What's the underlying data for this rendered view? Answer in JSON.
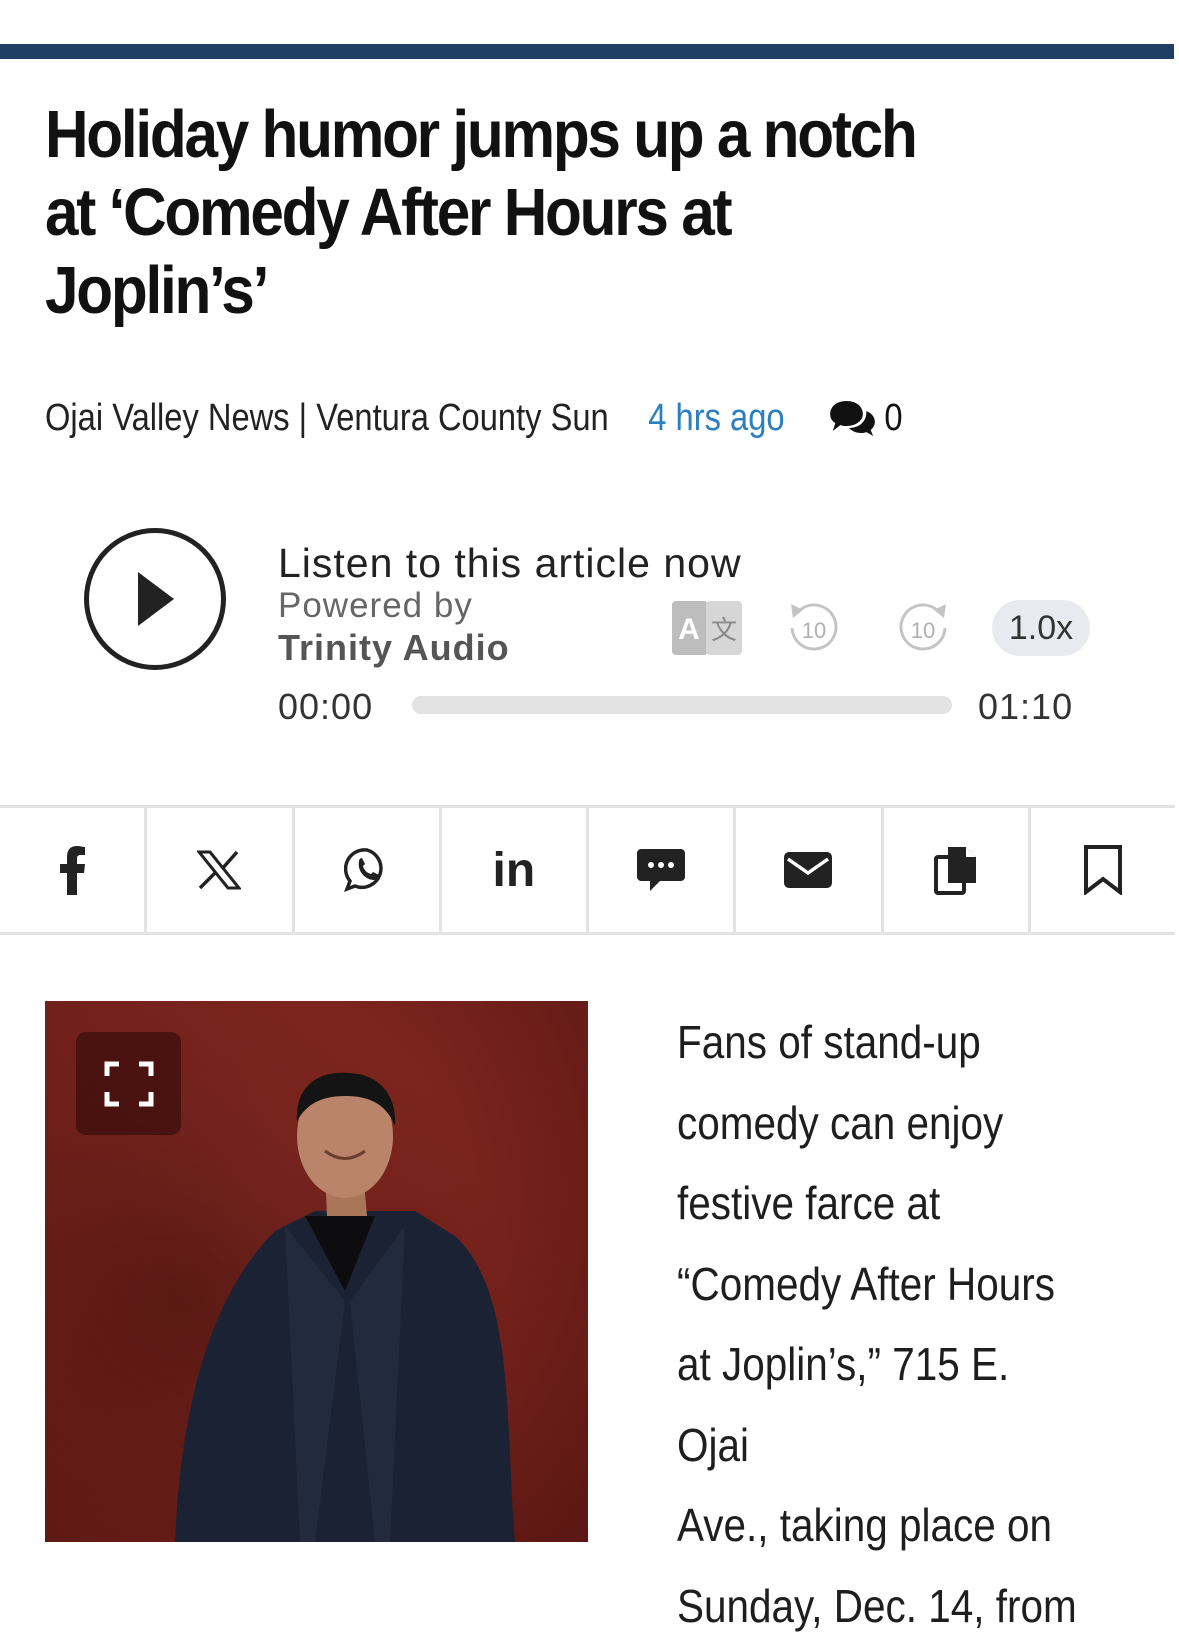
{
  "article": {
    "headline": "Holiday humor jumps up a notch at ‘Comedy After Hours at Joplin’s’",
    "source": "Ojai Valley News | Ventura County Sun",
    "time_ago": "4 hrs ago",
    "comment_count": "0",
    "body_lines": [
      "Fans of stand-up",
      "comedy can enjoy",
      "festive farce at",
      "“Comedy After Hours",
      "at Joplin’s,” 715 E. Ojai",
      "Ave., taking place on",
      "Sunday, Dec. 14, from"
    ]
  },
  "audio_player": {
    "title": "Listen to this article now",
    "powered_by": "Powered by",
    "provider": "Trinity Audio",
    "translate_label": "A文",
    "rewind_seconds": "10",
    "forward_seconds": "10",
    "speed": "1.0x",
    "current_time": "00:00",
    "duration": "01:10",
    "progress": 0
  },
  "share_bar": {
    "buttons": [
      "facebook-icon",
      "x-icon",
      "whatsapp-icon",
      "linkedin-icon",
      "sms-icon",
      "email-icon",
      "copy-icon",
      "bookmark-icon"
    ],
    "linkedin_label": "in"
  },
  "colors": {
    "brand_bar": "#1f3f66",
    "link_blue": "#2a7fc1",
    "photo_background": "#7a231d"
  }
}
